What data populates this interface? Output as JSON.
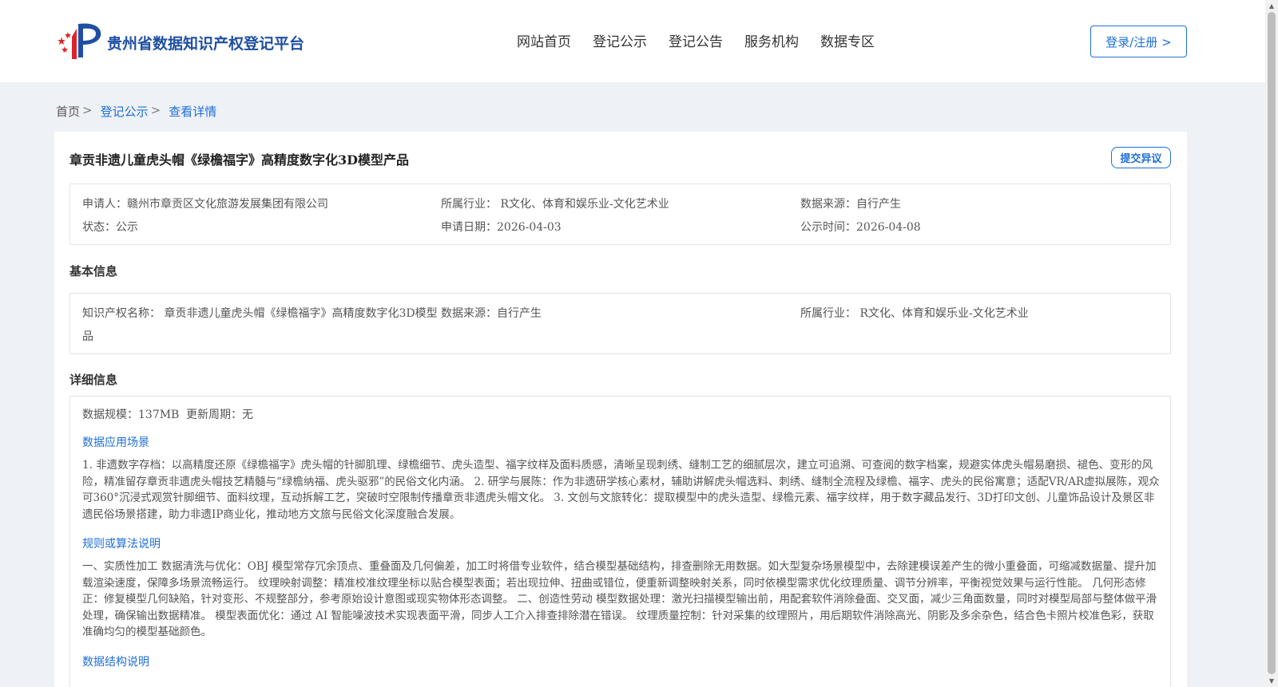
{
  "header": {
    "site_title": "贵州省数据知识产权登记平台",
    "nav": [
      "网站首页",
      "登记公示",
      "登记公告",
      "服务机构",
      "数据专区"
    ],
    "login_label": "登录/注册 >"
  },
  "breadcrumb": {
    "home": "首页",
    "sep": ">",
    "level1": "登记公示",
    "level2": "查看详情"
  },
  "detail": {
    "title": "章贡非遗儿童虎头帽《绿檐福字》高精度数字化3D模型产品",
    "objection_label": "提交异议",
    "summary": {
      "applicant": "申请人：赣州市章贡区文化旅游发展集团有限公司",
      "industry": "所属行业： R文化、体育和娱乐业-文化艺术业",
      "source": "数据来源：自行产生",
      "status": "状态：公示",
      "apply_date": "申请日期：2026-04-03",
      "publish_date": "公示时间：2026-04-08"
    },
    "basic_title": "基本信息",
    "basic": {
      "ip_name": "知识产权名称： 章贡非遗儿童虎头帽《绿檐福字》高精度数字化3D模型产",
      "ip_name_wrap": "品",
      "source": "数据来源：自行产生",
      "industry": "所属行业： R文化、体育和娱乐业-文化艺术业"
    },
    "detail_title": "详细信息",
    "info": {
      "scale": "数据规模：137MB",
      "cycle": "更新周期：无",
      "scenario_title": "数据应用场景",
      "scenario_text": "1. 非遗数字存档：以高精度还原《绿檐福字》虎头帽的针脚肌理、绿檐细节、虎头造型、福字纹样及面料质感，清晰呈现刺绣、缝制工艺的细腻层次，建立可追溯、可查阅的数字档案，规避实体虎头帽易磨损、褪色、变形的风险，精准留存章贡非遗虎头帽技艺精髓与“绿檐纳福、虎头驱邪”的民俗文化内涵。 2. 研学与展陈：作为非遗研学核心素材，辅助讲解虎头帽选料、刺绣、缝制全流程及绿檐、福字、虎头的民俗寓意；适配VR/AR虚拟展陈，观众可360°沉浸式观赏针脚细节、面料纹理，互动拆解工艺，突破时空限制传播章贡非遗虎头帽文化。 3. 文创与文旅转化：提取模型中的虎头造型、绿檐元素、福字纹样，用于数字藏品发行、3D打印文创、儿童饰品设计及景区非遗民俗场景搭建，助力非遗IP商业化，推动地方文旅与民俗文化深度融合发展。",
      "rules_title": "规则或算法说明",
      "rules_text": "一、实质性加工 数据清洗与优化：OBJ 模型常存冗余顶点、重叠面及几何偏差，加工时将借专业软件，结合模型基础结构，排查删除无用数据。如大型复杂场景模型中，去除建模误差产生的微小重叠面，可缩减数据量、提升加载渲染速度，保障多场景流畅运行。 纹理映射调整：精准校准纹理坐标以贴合模型表面；若出现拉伸、扭曲或错位，便重新调整映射关系，同时依模型需求优化纹理质量、调节分辨率，平衡视觉效果与运行性能。 几何形态修正：修复模型几何缺陷，针对变形、不规整部分，参考原始设计意图或现实物体形态调整。 二、创造性劳动 模型数据处理：激光扫描模型输出前，用配套软件消除叠面、交叉面，减少三角面数量，同时对模型局部与整体做平滑处理，确保输出数据精准。 模型表面优化：通过 AI 智能噪波技术实现表面平滑，同步人工介入排查排除潜在错误。 纹理质量控制：针对采集的纹理照片，用后期软件消除高光、阴影及多余杂色，结合色卡照片校准色彩，获取准确均匀的模型基础颜色。",
      "structure_title": "数据结构说明"
    }
  }
}
